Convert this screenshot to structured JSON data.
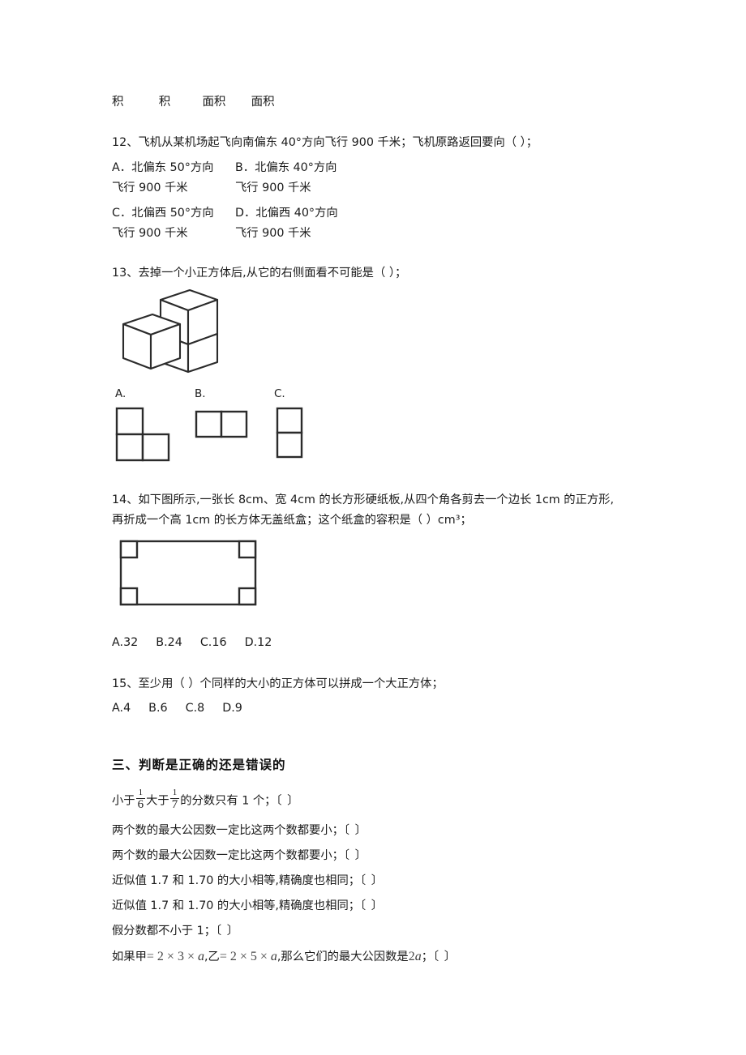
{
  "document": {
    "top_fragments": [
      "积",
      "积",
      "面积",
      "面积"
    ]
  },
  "questions": [
    {
      "number": "12、",
      "stem": "飞机从某机场起飞向南偏东 40°方向飞行 900 千米；飞机原路返回要向（      ）；",
      "options_grid": [
        {
          "a_label": "A．北偏东 50°方向",
          "b_label": "B．北偏东 40°方向"
        },
        {
          "a_label": "飞行 900 千米",
          "b_label": "飞行 900 千米"
        },
        {
          "a_label": "C．北偏西 50°方向",
          "b_label": "D．北偏西 40°方向"
        },
        {
          "a_label": "飞行 900 千米",
          "b_label": "飞行 900 千米"
        }
      ]
    },
    {
      "number": "13、",
      "stem": "去掉一个小正方体后,从它的右侧面看不可能是（     ）；",
      "shape_options": [
        {
          "label": "A.",
          "shape": "l-shape-three-squares"
        },
        {
          "label": "B.",
          "shape": "two-squares-horizontal"
        },
        {
          "label": "C.",
          "shape": "two-squares-vertical"
        }
      ]
    },
    {
      "number": "14、",
      "stem_line1": "如下图所示,一张长 8cm、宽 4cm 的长方形硬纸板,从四个角各剪去一个边长 1cm 的正方形,",
      "stem_line2": "再折成一个高 1cm 的长方体无盖纸盒；这个纸盒的容积是（      ）cm³；",
      "figure": "rectangle-with-four-corner-squares",
      "options": [
        "A.32",
        "B.24",
        "C.16",
        "D.12"
      ]
    },
    {
      "number": "15、",
      "stem": "至少用（     ）个同样的大小的正方体可以拼成一个大正方体；",
      "options": [
        "A.4",
        "B.6",
        "C.8",
        "D.9"
      ]
    }
  ],
  "section_three": {
    "heading": "三、判断是正确的还是错误的",
    "statements": [
      {
        "type": "fraction",
        "prefix": "小于",
        "frac1_num": "1",
        "frac1_den": "6",
        "middle": "大于",
        "frac2_num": "1",
        "frac2_den": "7",
        "suffix": "的分数只有 1 个；",
        "bracket": "〔       〕"
      },
      {
        "type": "plain",
        "text": "两个数的最大公因数一定比这两个数都要小；",
        "bracket": "〔      〕"
      },
      {
        "type": "plain",
        "text": "两个数的最大公因数一定比这两个数都要小；",
        "bracket": "〔      〕"
      },
      {
        "type": "plain",
        "text": "近似值 1.7 和 1.70 的大小相等,精确度也相同；",
        "bracket": "〔       〕"
      },
      {
        "type": "plain",
        "text": "近似值 1.7 和 1.70 的大小相等,精确度也相同；",
        "bracket": "〔       〕"
      },
      {
        "type": "plain",
        "text": "假分数都不小于 1；",
        "bracket": "〔      〕"
      },
      {
        "type": "math",
        "seg1": "如果甲",
        "eq1": "= 2 × 3 × ",
        "var1": "a",
        "seg2": ",乙",
        "eq2": "= 2 × 5 × ",
        "var2": "a",
        "seg3": ",那么它们的最大公因数是",
        "coef": "2",
        "var3": "a",
        "seg4": "；",
        "bracket": "〔     〕"
      }
    ]
  },
  "colors": {
    "text": "#1d1d1d",
    "math": "#4a4a4a",
    "stroke": "#2b2b2b",
    "background": "#ffffff"
  }
}
